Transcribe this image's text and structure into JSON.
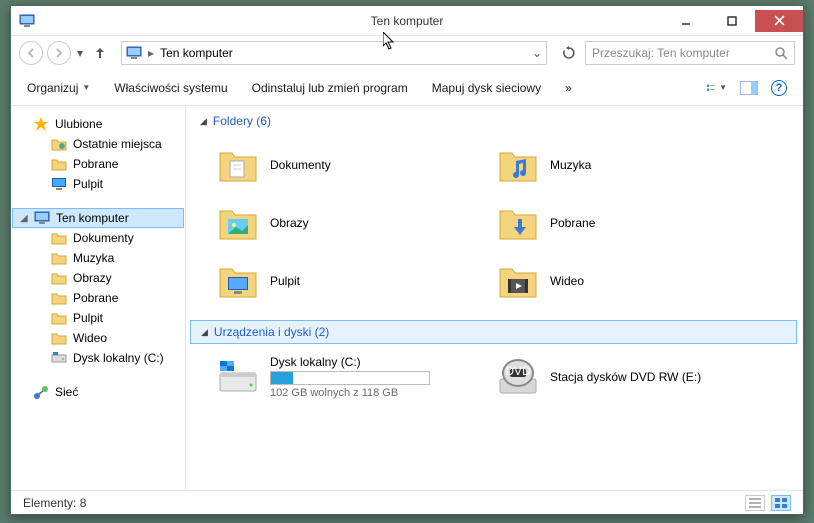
{
  "window": {
    "title": "Ten komputer"
  },
  "address": {
    "location": "Ten komputer"
  },
  "search": {
    "placeholder": "Przeszukaj: Ten komputer"
  },
  "commands": {
    "organize": "Organizuj",
    "properties": "Właściwości systemu",
    "uninstall": "Odinstaluj lub zmień program",
    "mapdrive": "Mapuj dysk sieciowy",
    "more": "»"
  },
  "nav": {
    "favorites": {
      "label": "Ulubione",
      "items": [
        "Ostatnie miejsca",
        "Pobrane",
        "Pulpit"
      ]
    },
    "computer": {
      "label": "Ten komputer",
      "items": [
        "Dokumenty",
        "Muzyka",
        "Obrazy",
        "Pobrane",
        "Pulpit",
        "Wideo",
        "Dysk lokalny (C:)"
      ]
    },
    "network": {
      "label": "Sieć"
    }
  },
  "groups": {
    "folders": {
      "header": "Foldery (6)",
      "items": [
        "Dokumenty",
        "Muzyka",
        "Obrazy",
        "Pobrane",
        "Pulpit",
        "Wideo"
      ]
    },
    "devices": {
      "header": "Urządzenia i dyski (2)",
      "disk": {
        "name": "Dysk lokalny (C:)",
        "free_text": "102 GB wolnych z 118 GB",
        "used_percent": 14
      },
      "dvd": {
        "name": "Stacja dysków DVD RW (E:)"
      }
    }
  },
  "status": {
    "count": "Elementy: 8"
  }
}
